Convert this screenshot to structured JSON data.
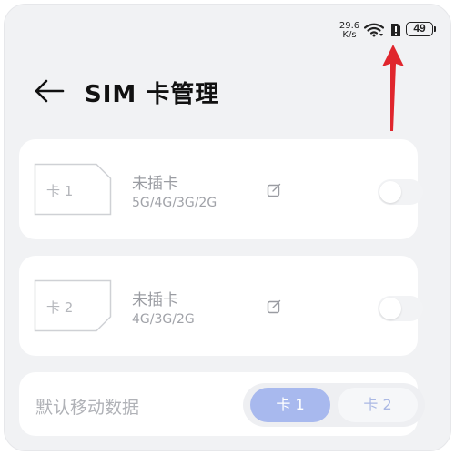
{
  "status_bar": {
    "speed_value": "29.6",
    "speed_unit": "K/s",
    "battery": "49",
    "wifi_icon": "wifi-icon",
    "alert_icon": "sim-alert-icon"
  },
  "header": {
    "title": "SIM 卡管理",
    "back_icon": "arrow-left-icon"
  },
  "sims": [
    {
      "slot_label": "卡 1",
      "status": "未插卡",
      "networks": "5G/4G/3G/2G",
      "enabled": false
    },
    {
      "slot_label": "卡 2",
      "status": "未插卡",
      "networks": "4G/3G/2G",
      "enabled": false
    }
  ],
  "default_data": {
    "label": "默认移动数据",
    "options": [
      "卡 1",
      "卡 2"
    ],
    "selected": "卡 1"
  },
  "colors": {
    "accent": "#a8b9ee",
    "annotation_arrow": "#e0262d"
  }
}
